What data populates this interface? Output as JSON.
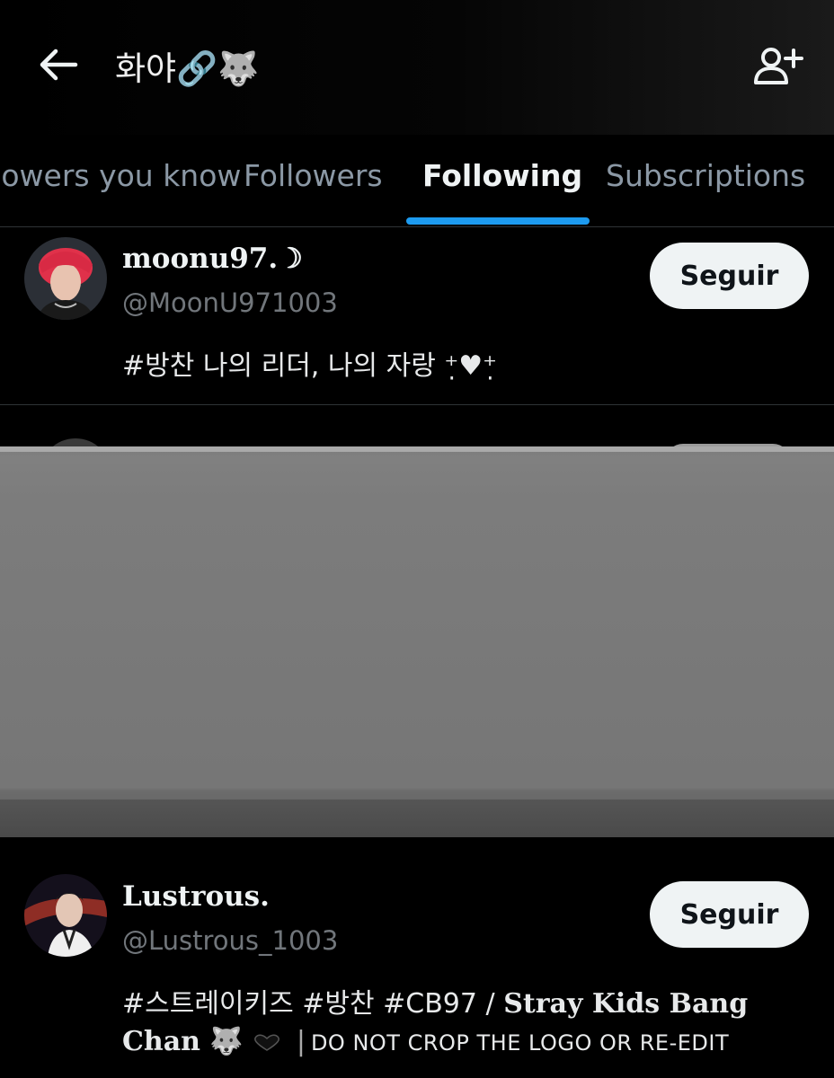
{
  "header": {
    "title": "화야🔗🐺",
    "back_icon": "arrow-left-icon",
    "add_user_icon": "person-plus-icon"
  },
  "tabs": [
    {
      "label": "Followers you know",
      "active": false
    },
    {
      "label": "Followers",
      "active": false
    },
    {
      "label": "Following",
      "active": true
    },
    {
      "label": "Subscriptions",
      "active": false
    }
  ],
  "users": [
    {
      "display_name": "moonu97.☽",
      "handle": "@MoonU971003",
      "bio": "#방찬 나의 리더, 나의 자랑 ⁺̣♥⁺̣",
      "follow_label": "Seguir"
    },
    {
      "display_name": "Lustrous.",
      "handle": "@Lustrous_1003",
      "bio_line1_tags": "#스트레이키즈 #방찬 #CB97 /",
      "bio_line1_name": "Stray Kids Bang",
      "bio_line2_name": "Chan 🐺",
      "bio_line2_notice": "DO NOT CROP THE LOGO OR RE-EDIT",
      "follow_label": "Seguir"
    }
  ],
  "colors": {
    "background": "#000000",
    "accent": "#1d9bf0",
    "secondary_text": "#71767b",
    "button_bg": "#eff3f4"
  }
}
